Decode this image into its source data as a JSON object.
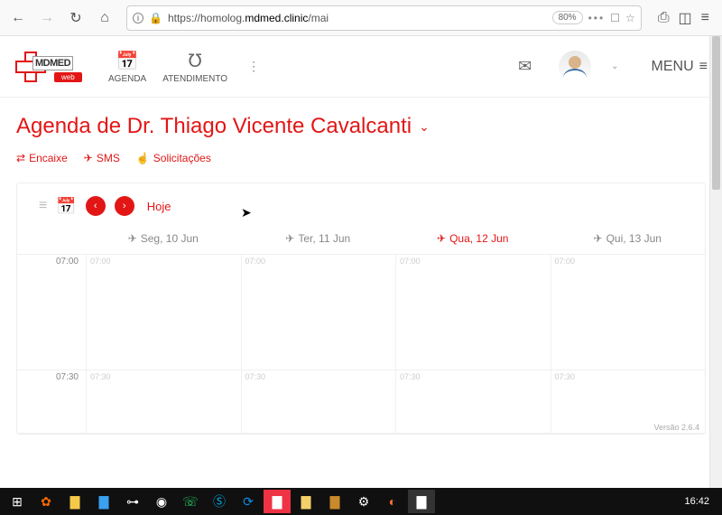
{
  "browser": {
    "url_prefix": "https://homolog.",
    "url_domain": "mdmed.clinic",
    "url_rest": "/mai",
    "zoom": "80%"
  },
  "header": {
    "logo_text": "MDMED",
    "logo_sub": "web",
    "agenda": "AGENDA",
    "atendimento": "ATENDIMENTO",
    "menu": "MENU"
  },
  "page": {
    "title": "Agenda de Dr. Thiago Vicente Cavalcanti",
    "actions": {
      "encaixe": "Encaixe",
      "sms": "SMS",
      "solicitacoes": "Solicitações"
    }
  },
  "calendar": {
    "today_label": "Hoje",
    "days": [
      {
        "label": "Seg, 10 Jun",
        "active": false
      },
      {
        "label": "Ter, 11 Jun",
        "active": false
      },
      {
        "label": "Qua, 12 Jun",
        "active": true
      },
      {
        "label": "Qui, 13 Jun",
        "active": false
      }
    ],
    "rows": [
      {
        "label": "07:00",
        "cell": "07:00"
      },
      {
        "label": "07:30",
        "cell": "07:30"
      }
    ],
    "version": "Versão 2.6.4"
  },
  "taskbar": {
    "clock": "16:42"
  }
}
